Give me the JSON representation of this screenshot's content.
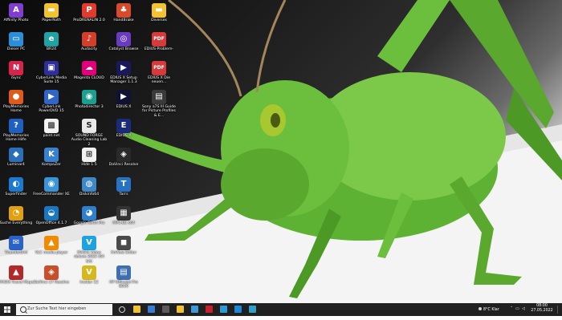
{
  "desktop_icons": [
    {
      "label": "Affinity Photo",
      "icon": "affinity-photo-icon",
      "color": "#7e3fd1",
      "glyph": "A",
      "col": 0,
      "row": 0
    },
    {
      "label": "Dieser PC",
      "icon": "this-pc-icon",
      "color": "#2a8fd8",
      "glyph": "▭",
      "col": 0,
      "row": 1
    },
    {
      "label": "iSync",
      "icon": "isync-icon",
      "color": "#d8234b",
      "glyph": "N",
      "col": 0,
      "row": 2
    },
    {
      "label": "PlayMemories Home",
      "icon": "playmemories-icon",
      "color": "#e05a1a",
      "glyph": "●",
      "col": 0,
      "row": 3
    },
    {
      "label": "PlayMemories Home Hilfe",
      "icon": "help-icon",
      "color": "#1f5fbf",
      "glyph": "?",
      "col": 0,
      "row": 4
    },
    {
      "label": "Luminar4",
      "icon": "luminar-icon",
      "color": "#2b6fb8",
      "glyph": "◆",
      "col": 0,
      "row": 5
    },
    {
      "label": "Superfinder",
      "icon": "superfinder-icon",
      "color": "#1a7ad1",
      "glyph": "◐",
      "col": 0,
      "row": 6
    },
    {
      "label": "Suche Everything",
      "icon": "everything-icon",
      "color": "#e0a010",
      "glyph": "◔",
      "col": 0,
      "row": 7
    },
    {
      "label": "Thunderbird",
      "icon": "thunderbird-icon",
      "color": "#2a62c7",
      "glyph": "✉",
      "col": 0,
      "row": 8
    },
    {
      "label": "MAGIX Travel Maps",
      "icon": "magix-travel-icon",
      "color": "#b32929",
      "glyph": "▲",
      "col": 0,
      "row": 9
    },
    {
      "label": "PaperRoth",
      "icon": "folder-icon",
      "color": "#f2c230",
      "glyph": "▬",
      "col": 1,
      "row": 0
    },
    {
      "label": "BR24",
      "icon": "edge-icon",
      "color": "#1fa3a3",
      "glyph": "e",
      "col": 1,
      "row": 1
    },
    {
      "label": "CyberLink Media Suite 15",
      "icon": "cyberlink-icon",
      "color": "#2f2f99",
      "glyph": "▣",
      "col": 1,
      "row": 2
    },
    {
      "label": "CyberLink PowerDVD 15",
      "icon": "powerdvd-icon",
      "color": "#2e66c9",
      "glyph": "▶",
      "col": 1,
      "row": 3
    },
    {
      "label": "paint.net",
      "icon": "paintnet-icon",
      "color": "#f3f3f3",
      "glyph": "▩",
      "col": 1,
      "row": 4
    },
    {
      "label": "KompoZer",
      "icon": "kompozer-icon",
      "color": "#3a80d0",
      "glyph": "K",
      "col": 1,
      "row": 5
    },
    {
      "label": "FreeCommander XE",
      "icon": "freecommander-icon",
      "color": "#3a94d8",
      "glyph": "◉",
      "col": 1,
      "row": 6
    },
    {
      "label": "OpenOffice 4.1.7",
      "icon": "openoffice-icon",
      "color": "#1a78c2",
      "glyph": "◒",
      "col": 1,
      "row": 7
    },
    {
      "label": "VLC media player",
      "icon": "vlc-icon",
      "color": "#f08a00",
      "glyph": "▲",
      "col": 1,
      "row": 8
    },
    {
      "label": "DaVinci 17 Resolve",
      "icon": "davinci-icon",
      "color": "#c84f2a",
      "glyph": "◈",
      "col": 1,
      "row": 9
    },
    {
      "label": "ProDRENALIN 2.0",
      "icon": "prodrenalin-icon",
      "color": "#e23b2e",
      "glyph": "P",
      "col": 2,
      "row": 0
    },
    {
      "label": "Audacity",
      "icon": "audacity-icon",
      "color": "#d33f2a",
      "glyph": "♪",
      "col": 2,
      "row": 1
    },
    {
      "label": "Magenta CLOUD",
      "icon": "magenta-cloud-icon",
      "color": "#e2007a",
      "glyph": "☁",
      "col": 2,
      "row": 2
    },
    {
      "label": "Photodirector 3",
      "icon": "photodirector-icon",
      "color": "#19a08f",
      "glyph": "◉",
      "col": 2,
      "row": 3
    },
    {
      "label": "SOUND FORGE Audio Cleaning Lab 2",
      "icon": "soundforge-icon",
      "color": "#e9e9e9",
      "glyph": "S",
      "col": 2,
      "row": 4
    },
    {
      "label": "Hide 1.5",
      "icon": "hide-icon",
      "color": "#f0f0f0",
      "glyph": "⊞",
      "col": 2,
      "row": 5
    },
    {
      "label": "Diskinfo64",
      "icon": "diskinfo-icon",
      "color": "#3f88c8",
      "glyph": "◍",
      "col": 2,
      "row": 6
    },
    {
      "label": "Google Earth Pro",
      "icon": "google-earth-icon",
      "color": "#2f7fcf",
      "glyph": "◕",
      "col": 2,
      "row": 7
    },
    {
      "label": "MAGIX Video deluxe 2022 (64 bit)",
      "icon": "magix-video-icon",
      "color": "#1fa3e0",
      "glyph": "V",
      "col": 2,
      "row": 8
    },
    {
      "label": "Insider 12",
      "icon": "insider-icon",
      "color": "#d4b81e",
      "glyph": "V",
      "col": 2,
      "row": 9
    },
    {
      "label": "HandBrake",
      "icon": "handbrake-icon",
      "color": "#d94a2a",
      "glyph": "♣",
      "col": 3,
      "row": 0
    },
    {
      "label": "Catalyst Browse",
      "icon": "catalyst-icon",
      "color": "#6a3bbf",
      "glyph": "◎",
      "col": 3,
      "row": 1
    },
    {
      "label": "EDIUS X Setup Manager 1.1.3",
      "icon": "edius-setup-icon",
      "color": "#1a1a5a",
      "glyph": "▶",
      "col": 3,
      "row": 2
    },
    {
      "label": "EDIUS X",
      "icon": "edius-icon",
      "color": "#111133",
      "glyph": "▶",
      "col": 3,
      "row": 3
    },
    {
      "label": "EDIUS X",
      "icon": "edius-shortcut-icon",
      "color": "#1c2a7a",
      "glyph": "E",
      "col": 3,
      "row": 4
    },
    {
      "label": "DaVinci Resolve",
      "icon": "davinci-resolve-icon",
      "color": "#2a2a2a",
      "glyph": "◈",
      "col": 3,
      "row": 5
    },
    {
      "label": "Tarrs",
      "icon": "tarrs-icon",
      "color": "#2672c4",
      "glyph": "T",
      "col": 3,
      "row": 6
    },
    {
      "label": "MPC-BE x64",
      "icon": "mpc-be-icon",
      "color": "#333333",
      "glyph": "▦",
      "col": 3,
      "row": 7
    },
    {
      "label": "XnView Editor",
      "icon": "xnview-icon",
      "color": "#4a4a4a",
      "glyph": "◼",
      "col": 3,
      "row": 8
    },
    {
      "label": "HP Officejet Pro 8610",
      "icon": "hp-printer-icon",
      "color": "#3d6fb2",
      "glyph": "▤",
      "col": 3,
      "row": 9
    },
    {
      "label": "Diverses",
      "icon": "folder-icon",
      "color": "#f2c230",
      "glyph": "▬",
      "col": 4,
      "row": 0
    },
    {
      "label": "EDIUS-Problem-",
      "icon": "pdf-icon",
      "color": "#d73a3a",
      "glyph": "PDF",
      "col": 4,
      "row": 1
    },
    {
      "label": "EDIUS X Die neuen...",
      "icon": "pdf-icon",
      "color": "#d73a3a",
      "glyph": "PDF",
      "col": 4,
      "row": 2
    },
    {
      "label": "Sony a7S III Guide for Picture Profiles & E...",
      "icon": "document-icon",
      "color": "#3a3a3a",
      "glyph": "▤",
      "col": 4,
      "row": 3
    }
  ],
  "taskbar": {
    "search_placeholder": "Zur Suche Text hier eingeben",
    "apps": [
      {
        "icon": "task-view-icon",
        "color": "#d0d0d0"
      },
      {
        "icon": "file-explorer-icon",
        "color": "#f2c230"
      },
      {
        "icon": "mail-icon",
        "color": "#3a7bd5"
      },
      {
        "icon": "calculator-icon",
        "color": "#5a5a5a"
      },
      {
        "icon": "folder-icon",
        "color": "#f2c230"
      },
      {
        "icon": "photos-icon",
        "color": "#3a9bd8"
      },
      {
        "icon": "filezilla-icon",
        "color": "#c8202a"
      },
      {
        "icon": "media-icon",
        "color": "#2a9bd8"
      },
      {
        "icon": "onedrive-icon",
        "color": "#1e88d8"
      },
      {
        "icon": "edge-icon",
        "color": "#2fa0c8"
      }
    ],
    "weather": "8°C Klar",
    "time": "08:00",
    "date": "27.05.2022"
  }
}
